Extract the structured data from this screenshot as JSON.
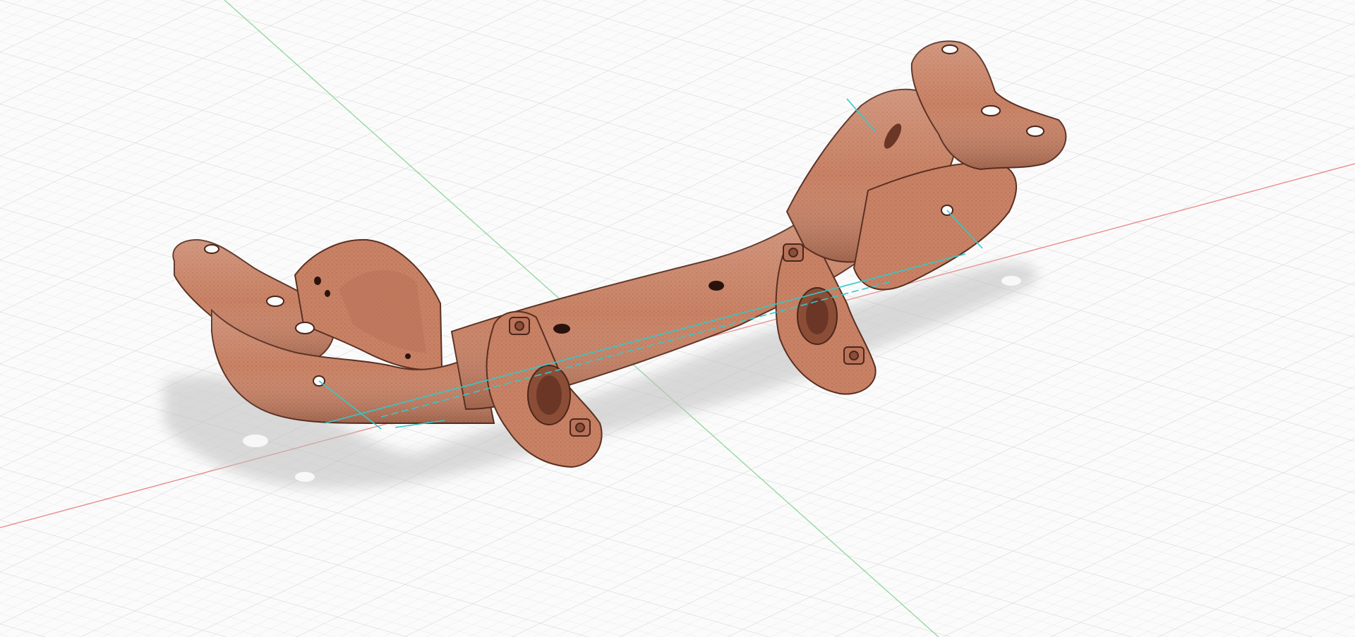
{
  "app": {
    "view": "3D viewport",
    "background_color": "#fbfbfb"
  },
  "scene": {
    "model_name": "",
    "model_icon": "subframe-mesh-icon",
    "model_color": "#c98265",
    "model_shadow_color": "#dcdcdc",
    "grid": true,
    "grid_color": "#d6d6d6",
    "grid_major_color": "#c4c4c4",
    "axes": {
      "x_axis_color": "#e06060",
      "y_axis_color": "#7fd08a",
      "sketch_line_color": "#33c9c9"
    }
  }
}
